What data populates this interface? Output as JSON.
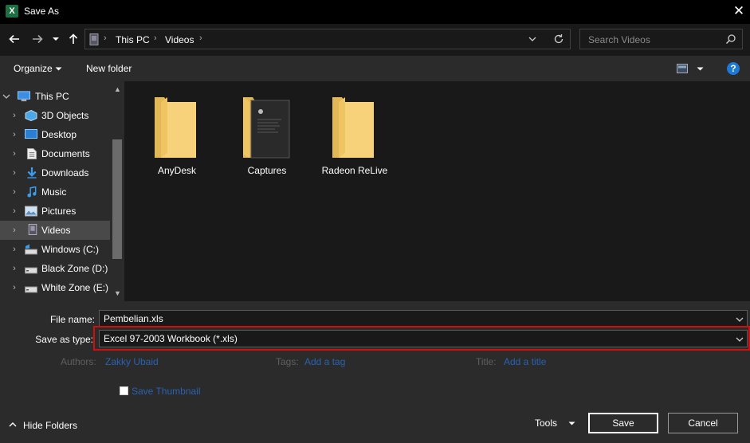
{
  "window": {
    "title": "Save As",
    "app_icon_letter": "X"
  },
  "nav": {
    "back_icon": "arrow-left-icon",
    "forward_icon": "arrow-right-icon",
    "recent_icon": "chevron-down-icon",
    "up_icon": "arrow-up-icon"
  },
  "address": {
    "crumbs": [
      "This PC",
      "Videos"
    ],
    "separator": "›"
  },
  "search": {
    "placeholder": "Search Videos"
  },
  "toolbar": {
    "organize": "Organize",
    "new_folder": "New folder"
  },
  "sidebar": {
    "root": "This PC",
    "items": [
      {
        "label": "3D Objects",
        "icon": "cube-icon"
      },
      {
        "label": "Desktop",
        "icon": "desktop-icon"
      },
      {
        "label": "Documents",
        "icon": "document-icon"
      },
      {
        "label": "Downloads",
        "icon": "download-icon"
      },
      {
        "label": "Music",
        "icon": "music-icon"
      },
      {
        "label": "Pictures",
        "icon": "picture-icon"
      },
      {
        "label": "Videos",
        "icon": "video-icon",
        "selected": true
      },
      {
        "label": "Windows (C:)",
        "icon": "drive-icon"
      },
      {
        "label": "Black Zone (D:)",
        "icon": "drive-icon"
      },
      {
        "label": "White Zone (E:)",
        "icon": "drive-icon"
      }
    ]
  },
  "folders": [
    {
      "name": "AnyDesk"
    },
    {
      "name": "Captures"
    },
    {
      "name": "Radeon ReLive"
    }
  ],
  "form": {
    "file_name_label": "File name:",
    "file_name_value": "Pembelian.xls",
    "save_type_label": "Save as type:",
    "save_type_value": "Excel 97-2003 Workbook (*.xls)",
    "authors_label": "Authors:",
    "authors_value": "Zakky Ubaid",
    "tags_label": "Tags:",
    "tags_value": "Add a tag",
    "title_label": "Title:",
    "title_value": "Add a title",
    "thumbnail_label": "Save Thumbnail"
  },
  "footer": {
    "hide_folders": "Hide Folders",
    "tools": "Tools",
    "save": "Save",
    "cancel": "Cancel"
  },
  "colors": {
    "highlight": "#d20f0f",
    "folder_yellow": "#f7d27a",
    "link_blue": "#2a62b0",
    "help_blue": "#1e78d6"
  }
}
